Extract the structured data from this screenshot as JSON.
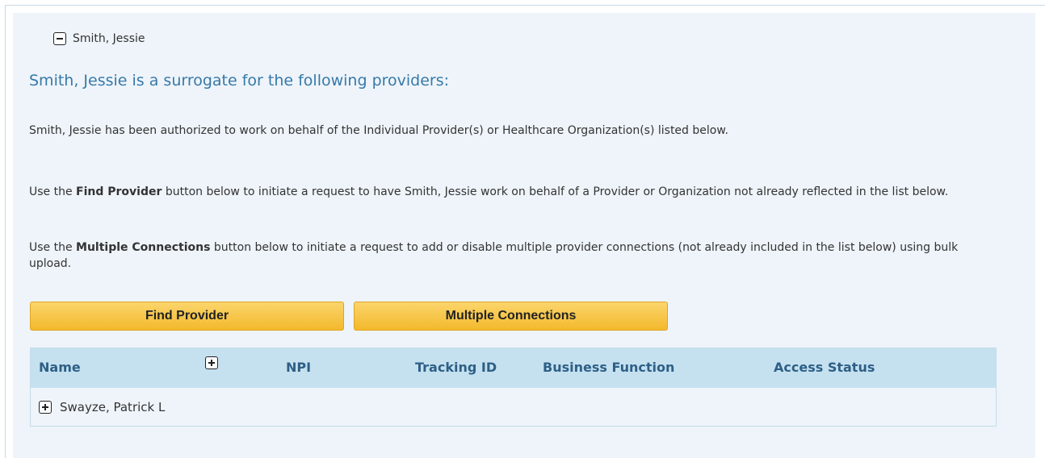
{
  "surrogate": {
    "name": "Smith, Jessie"
  },
  "heading": "Smith, Jessie is a surrogate for the following providers:",
  "paragraphs": {
    "p1": "Smith, Jessie has been authorized to work on behalf of the Individual Provider(s) or Healthcare Organization(s) listed below.",
    "p2_pre": "Use the ",
    "p2_bold": "Find Provider",
    "p2_post": " button below to initiate a request to have Smith, Jessie work on behalf of a Provider or Organization not already reflected in the list below.",
    "p3_pre": "Use the ",
    "p3_bold": "Multiple Connections",
    "p3_post": " button below to initiate a request to add or disable multiple provider connections (not already included in the list below) using bulk upload."
  },
  "buttons": {
    "find_provider": "Find Provider",
    "multiple_connections": "Multiple Connections"
  },
  "table": {
    "columns": {
      "name": "Name",
      "npi": "NPI",
      "tracking_id": "Tracking ID",
      "business_function": "Business Function",
      "access_status": "Access Status"
    },
    "rows": [
      {
        "name": "Swayze, Patrick L"
      }
    ]
  },
  "colors": {
    "heading": "#3779a8",
    "header_bg": "#c5e1f0",
    "panel_bg": "#eef4fa",
    "button": "#f3b92c"
  }
}
